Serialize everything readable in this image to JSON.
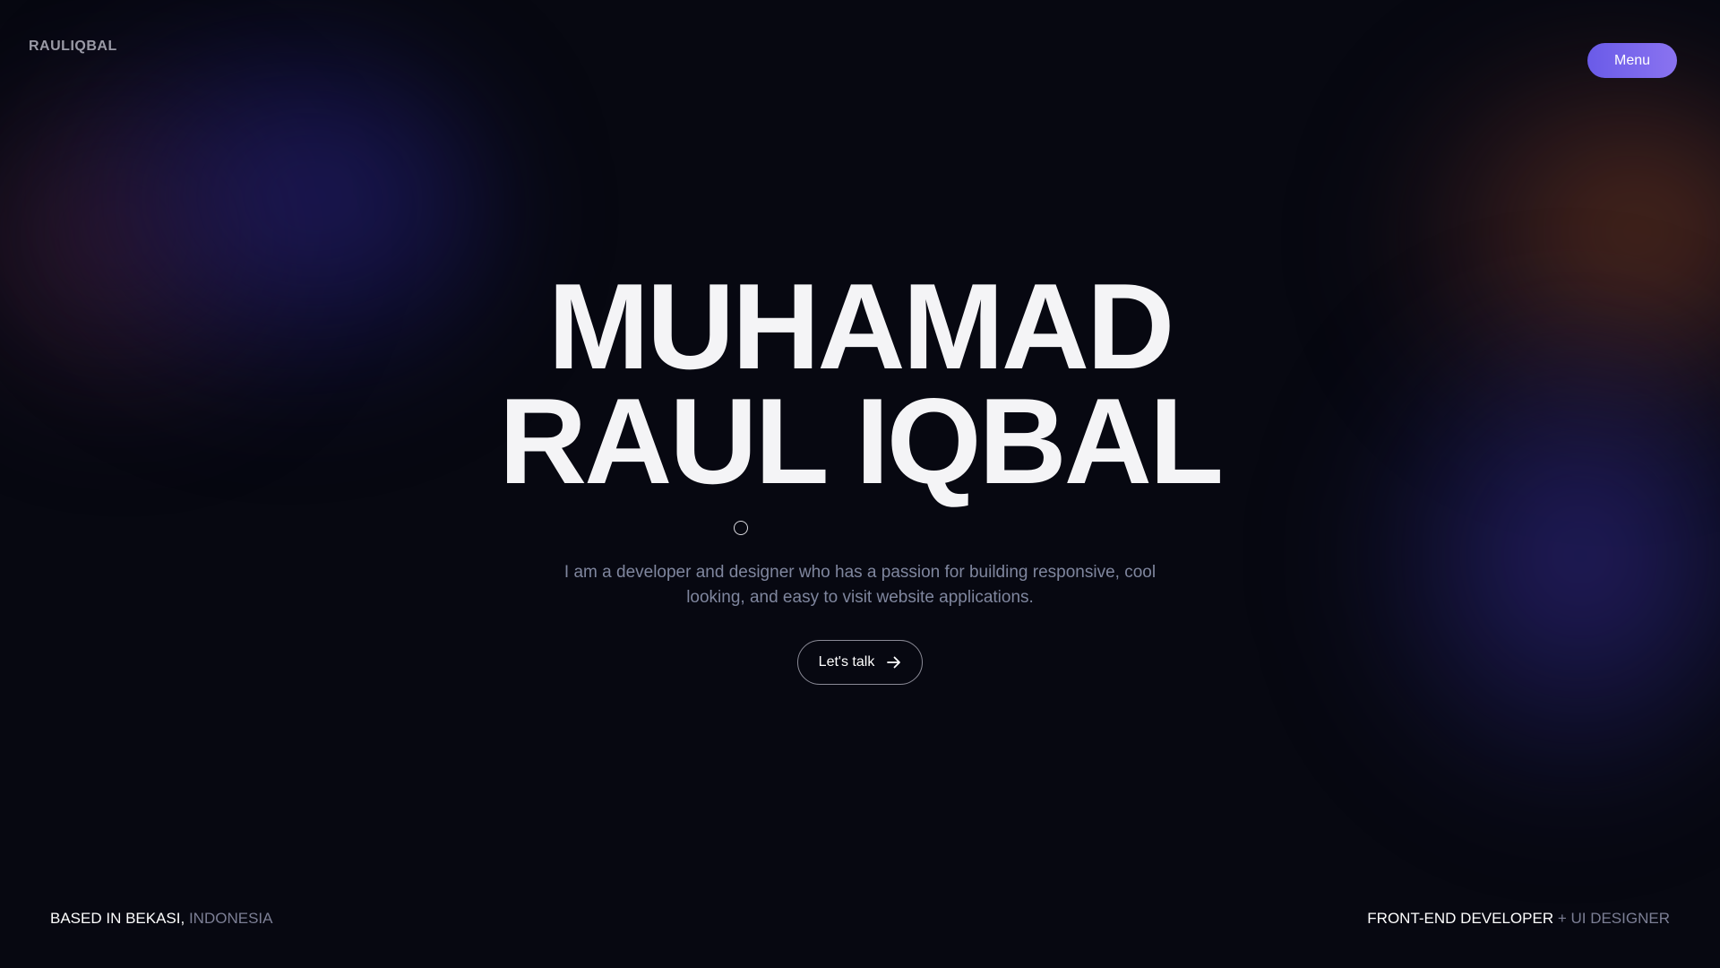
{
  "header": {
    "brand": "RAULIQBAL",
    "menu_label": "Menu"
  },
  "hero": {
    "title_line1": "MUHAMAD",
    "title_line2": "RAUL IQBAL",
    "description": "I am a developer and designer who has a passion for building responsive, cool looking, and easy to visit website applications.",
    "cta_label": "Let's talk",
    "cta_icon": "arrow-right-icon"
  },
  "footer": {
    "location_primary": "BASED IN BEKASI",
    "location_separator": ", ",
    "location_secondary": "INDONESIA",
    "role_primary": "FRONT-END DEVELOPER",
    "role_separator": " + ",
    "role_secondary": "UI DESIGNER"
  },
  "colors": {
    "background": "#070811",
    "accent": "#7b68ee",
    "text_primary": "#f4f4f6",
    "text_muted": "#7f869e"
  }
}
